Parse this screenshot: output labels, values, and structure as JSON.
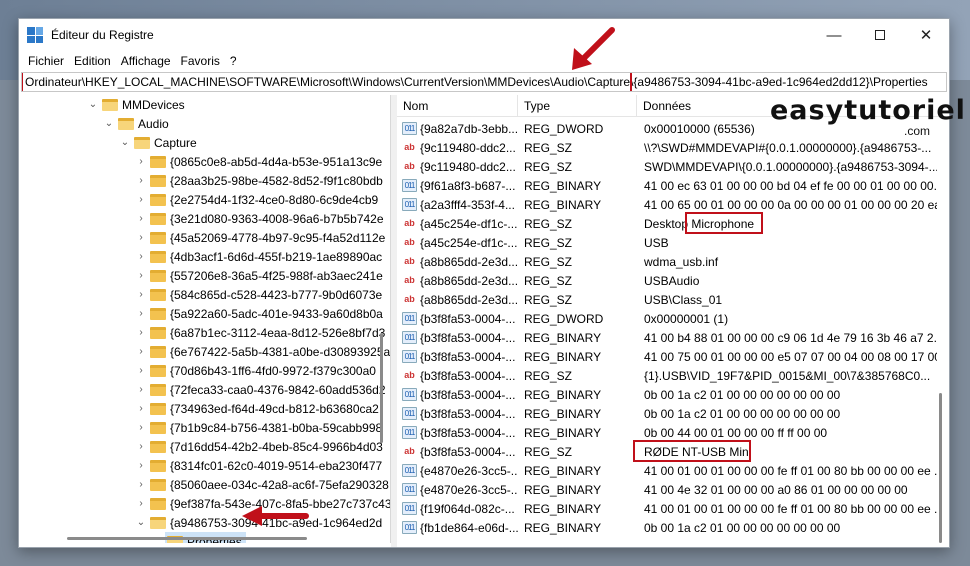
{
  "window": {
    "title": "Éditeur du Registre"
  },
  "menu": [
    "Fichier",
    "Edition",
    "Affichage",
    "Favoris",
    "?"
  ],
  "address": "Ordinateur\\HKEY_LOCAL_MACHINE\\SOFTWARE\\Microsoft\\Windows\\CurrentVersion\\MMDevices\\Audio\\Capture\\{a9486753-3094-41bc-a9ed-1c964ed2dd12}\\Properties",
  "tree": {
    "mmdevices": "MMDevices",
    "audio": "Audio",
    "capture": "Capture",
    "keys": [
      "{0865c0e8-ab5d-4d4a-b53e-951a13c9e",
      "{28aa3b25-98be-4582-8d52-f9f1c80bdb",
      "{2e2754d4-1f32-4ce0-8d80-6c9de4cb9",
      "{3e21d080-9363-4008-96a6-b7b5b742e",
      "{45a52069-4778-4b97-9c95-f4a52d112e",
      "{4db3acf1-6d6d-455f-b219-1ae89890ac",
      "{557206e8-36a5-4f25-988f-ab3aec241e",
      "{584c865d-c528-4423-b777-9b0d6073e",
      "{5a922a60-5adc-401e-9433-9a60d8b0a",
      "{6a87b1ec-3112-4eaa-8d12-526e8bf7d3",
      "{6e767422-5a5b-4381-a0be-d30893925a",
      "{70d86b43-1ff6-4fd0-9972-f379c300a0",
      "{72feca33-caa0-4376-9842-60add536d2",
      "{734963ed-f64d-49cd-b812-b63680ca2",
      "{7b1b9c84-b756-4381-b0ba-59cabb998",
      "{7d16dd54-42b2-4beb-85c4-9966b4d03",
      "{8314fc01-62c0-4019-9514-eba230f477",
      "{85060aee-034c-42a8-ac6f-75efa290328",
      "{9ef387fa-543e-407c-8fa5-bbe27c737c43",
      "{a9486753-3094-41bc-a9ed-1c964ed2d"
    ],
    "properties": "Properties"
  },
  "list": {
    "headers": [
      "Nom",
      "Type",
      "Données"
    ],
    "rows": [
      {
        "icon": "bin",
        "name": "{9a82a7db-3ebb...",
        "type": "REG_DWORD",
        "data": "0x00010000 (65536)"
      },
      {
        "icon": "ab",
        "name": "{9c119480-ddc2...",
        "type": "REG_SZ",
        "data": "\\\\?\\SWD#MMDEVAPI#{0.0.1.00000000}.{a9486753-..."
      },
      {
        "icon": "ab",
        "name": "{9c119480-ddc2...",
        "type": "REG_SZ",
        "data": "SWD\\MMDEVAPI\\{0.0.1.00000000}.{a9486753-3094-..."
      },
      {
        "icon": "bin",
        "name": "{9f61a8f3-b687-...",
        "type": "REG_BINARY",
        "data": "41 00 ec 63 01 00 00 00 bd 04 ef fe 00 00 01 00 00 00..."
      },
      {
        "icon": "bin",
        "name": "{a2a3fff4-353f-4...",
        "type": "REG_BINARY",
        "data": "41 00 65 00 01 00 00 00 0a 00 00 00 01 00 00 00 20 ea..."
      },
      {
        "icon": "ab",
        "name": "{a45c254e-df1c-...",
        "type": "REG_SZ",
        "data": "Desktop Microphone"
      },
      {
        "icon": "ab",
        "name": "{a45c254e-df1c-...",
        "type": "REG_SZ",
        "data": "USB"
      },
      {
        "icon": "ab",
        "name": "{a8b865dd-2e3d...",
        "type": "REG_SZ",
        "data": "wdma_usb.inf"
      },
      {
        "icon": "ab",
        "name": "{a8b865dd-2e3d...",
        "type": "REG_SZ",
        "data": "USBAudio"
      },
      {
        "icon": "ab",
        "name": "{a8b865dd-2e3d...",
        "type": "REG_SZ",
        "data": "USB\\Class_01"
      },
      {
        "icon": "bin",
        "name": "{b3f8fa53-0004-...",
        "type": "REG_DWORD",
        "data": "0x00000001 (1)"
      },
      {
        "icon": "bin",
        "name": "{b3f8fa53-0004-...",
        "type": "REG_BINARY",
        "data": "41 00 b4 88 01 00 00 00 c9 06 1d 4e 79 16 3b 46 a7 2..."
      },
      {
        "icon": "bin",
        "name": "{b3f8fa53-0004-...",
        "type": "REG_BINARY",
        "data": "41 00 75 00 01 00 00 00 e5 07 07 00 04 00 08 00 17 00..."
      },
      {
        "icon": "ab",
        "name": "{b3f8fa53-0004-...",
        "type": "REG_SZ",
        "data": "{1}.USB\\VID_19F7&PID_0015&MI_00\\7&385768C0..."
      },
      {
        "icon": "bin",
        "name": "{b3f8fa53-0004-...",
        "type": "REG_BINARY",
        "data": "0b 00 1a c2 01 00 00 00 00 00 00 00"
      },
      {
        "icon": "bin",
        "name": "{b3f8fa53-0004-...",
        "type": "REG_BINARY",
        "data": "0b 00 1a c2 01 00 00 00 00 00 00 00"
      },
      {
        "icon": "bin",
        "name": "{b3f8fa53-0004-...",
        "type": "REG_BINARY",
        "data": "0b 00 44 00 01 00 00 00 ff ff 00 00"
      },
      {
        "icon": "ab",
        "name": "{b3f8fa53-0004-...",
        "type": "REG_SZ",
        "data": "RØDE NT-USB Mini"
      },
      {
        "icon": "bin",
        "name": "{e4870e26-3cc5-...",
        "type": "REG_BINARY",
        "data": "41 00 01 00 01 00 00 00 fe ff 01 00 80 bb 00 00 00 ee ..."
      },
      {
        "icon": "bin",
        "name": "{e4870e26-3cc5-...",
        "type": "REG_BINARY",
        "data": "41 00 4e 32 01 00 00 00 a0 86 01 00 00 00 00 00"
      },
      {
        "icon": "bin",
        "name": "{f19f064d-082c-...",
        "type": "REG_BINARY",
        "data": "41 00 01 00 01 00 00 00 fe ff 01 00 80 bb 00 00 00 ee ..."
      },
      {
        "icon": "bin",
        "name": "{fb1de864-e06d-...",
        "type": "REG_BINARY",
        "data": "0b 00 1a c2 01 00 00 00 00 00 00 00"
      }
    ]
  },
  "brand": {
    "name": "easytutoriel",
    "tld": ".com"
  },
  "colors": {
    "highlight": "#c0101a",
    "selection": "#cde3f7"
  }
}
